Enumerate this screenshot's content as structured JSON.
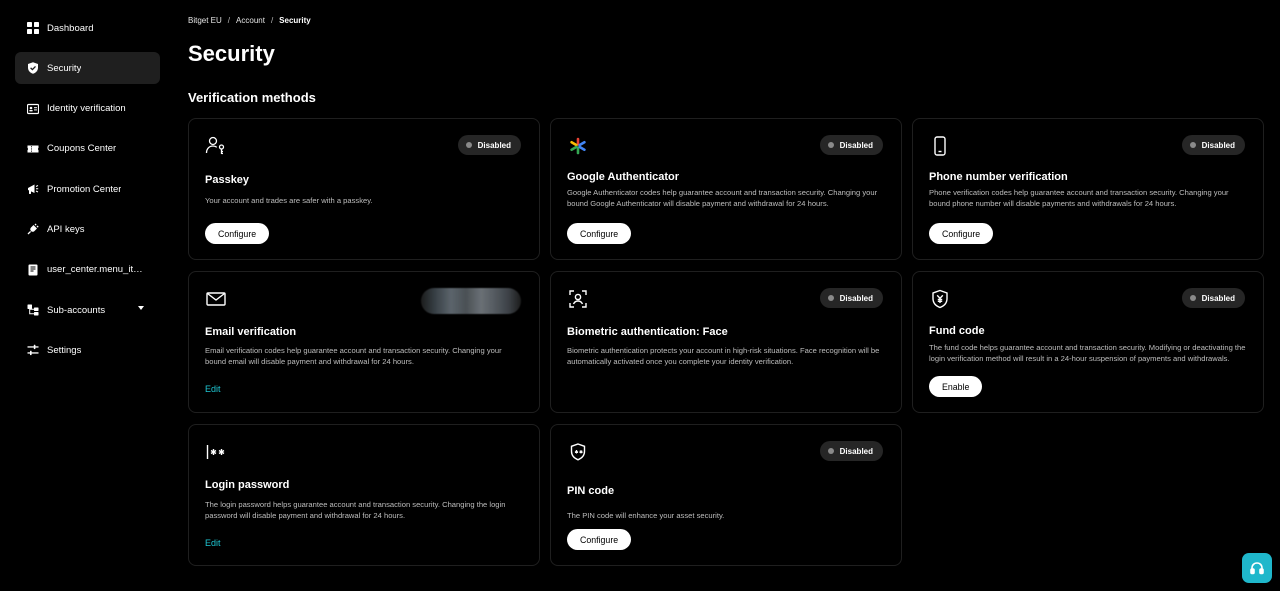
{
  "sidebar": {
    "items": [
      {
        "label": "Dashboard",
        "icon": "dashboard-icon"
      },
      {
        "label": "Security",
        "icon": "shield-icon",
        "active": true
      },
      {
        "label": "Identity verification",
        "icon": "id-card-icon"
      },
      {
        "label": "Coupons Center",
        "icon": "ticket-icon"
      },
      {
        "label": "Promotion Center",
        "icon": "megaphone-icon"
      },
      {
        "label": "API keys",
        "icon": "plug-icon"
      },
      {
        "label": "user_center.menu_ite...",
        "icon": "notebook-icon"
      },
      {
        "label": "Sub-accounts",
        "icon": "sub-accounts-icon",
        "has_caret": true
      },
      {
        "label": "Settings",
        "icon": "sliders-icon"
      }
    ]
  },
  "breadcrumb": {
    "items": [
      "Bitget EU",
      "Account",
      "Security"
    ],
    "separator": "/"
  },
  "page": {
    "title": "Security",
    "section_title": "Verification methods"
  },
  "cards": {
    "passkey": {
      "title": "Passkey",
      "description": "Your account and trades are safer with a passkey.",
      "status": "Disabled",
      "action": "Configure",
      "icon": "passkey-icon"
    },
    "google_auth": {
      "title": "Google Authenticator",
      "description": "Google Authenticator codes help guarantee account and transaction security. Changing your bound Google Authenticator will disable payment and withdrawal for 24 hours.",
      "status": "Disabled",
      "action": "Configure",
      "icon": "google-authenticator-icon"
    },
    "phone": {
      "title": "Phone number verification",
      "description": "Phone verification codes help guarantee account and transaction security. Changing your bound phone number will disable payments and withdrawals for 24 hours.",
      "status": "Disabled",
      "action": "Configure",
      "icon": "phone-icon"
    },
    "email": {
      "title": "Email verification",
      "description": "Email verification codes help guarantee account and transaction security. Changing your bound email will disable payment and withdrawal for 24 hours.",
      "action": "Edit",
      "icon": "mail-icon"
    },
    "biometric": {
      "title": "Biometric authentication: Face",
      "description": "Biometric authentication protects your account in high-risk situations. Face recognition will be automatically activated once you complete your identity verification.",
      "status": "Disabled",
      "icon": "face-scan-icon"
    },
    "fund_code": {
      "title": "Fund code",
      "description": "The fund code helps guarantee account and transaction security. Modifying or deactivating the login verification method will result in a 24-hour suspension of payments and withdrawals.",
      "status": "Disabled",
      "action": "Enable",
      "icon": "fund-shield-icon"
    },
    "login_password": {
      "title": "Login password",
      "description": "The login password helps guarantee account and transaction security. Changing the login password will disable payment and withdrawal for 24 hours.",
      "action": "Edit",
      "icon": "password-icon"
    },
    "pin_code": {
      "title": "PIN code",
      "description": "The PIN code will enhance your asset security.",
      "status": "Disabled",
      "action": "Configure",
      "icon": "pin-shield-icon"
    }
  },
  "support": {
    "icon": "headset-icon"
  },
  "colors": {
    "background": "#000000",
    "card_border": "#1f1f1f",
    "badge_bg": "#262626",
    "accent_link": "#1fc7d4",
    "support_button": "#1fb7cb"
  }
}
